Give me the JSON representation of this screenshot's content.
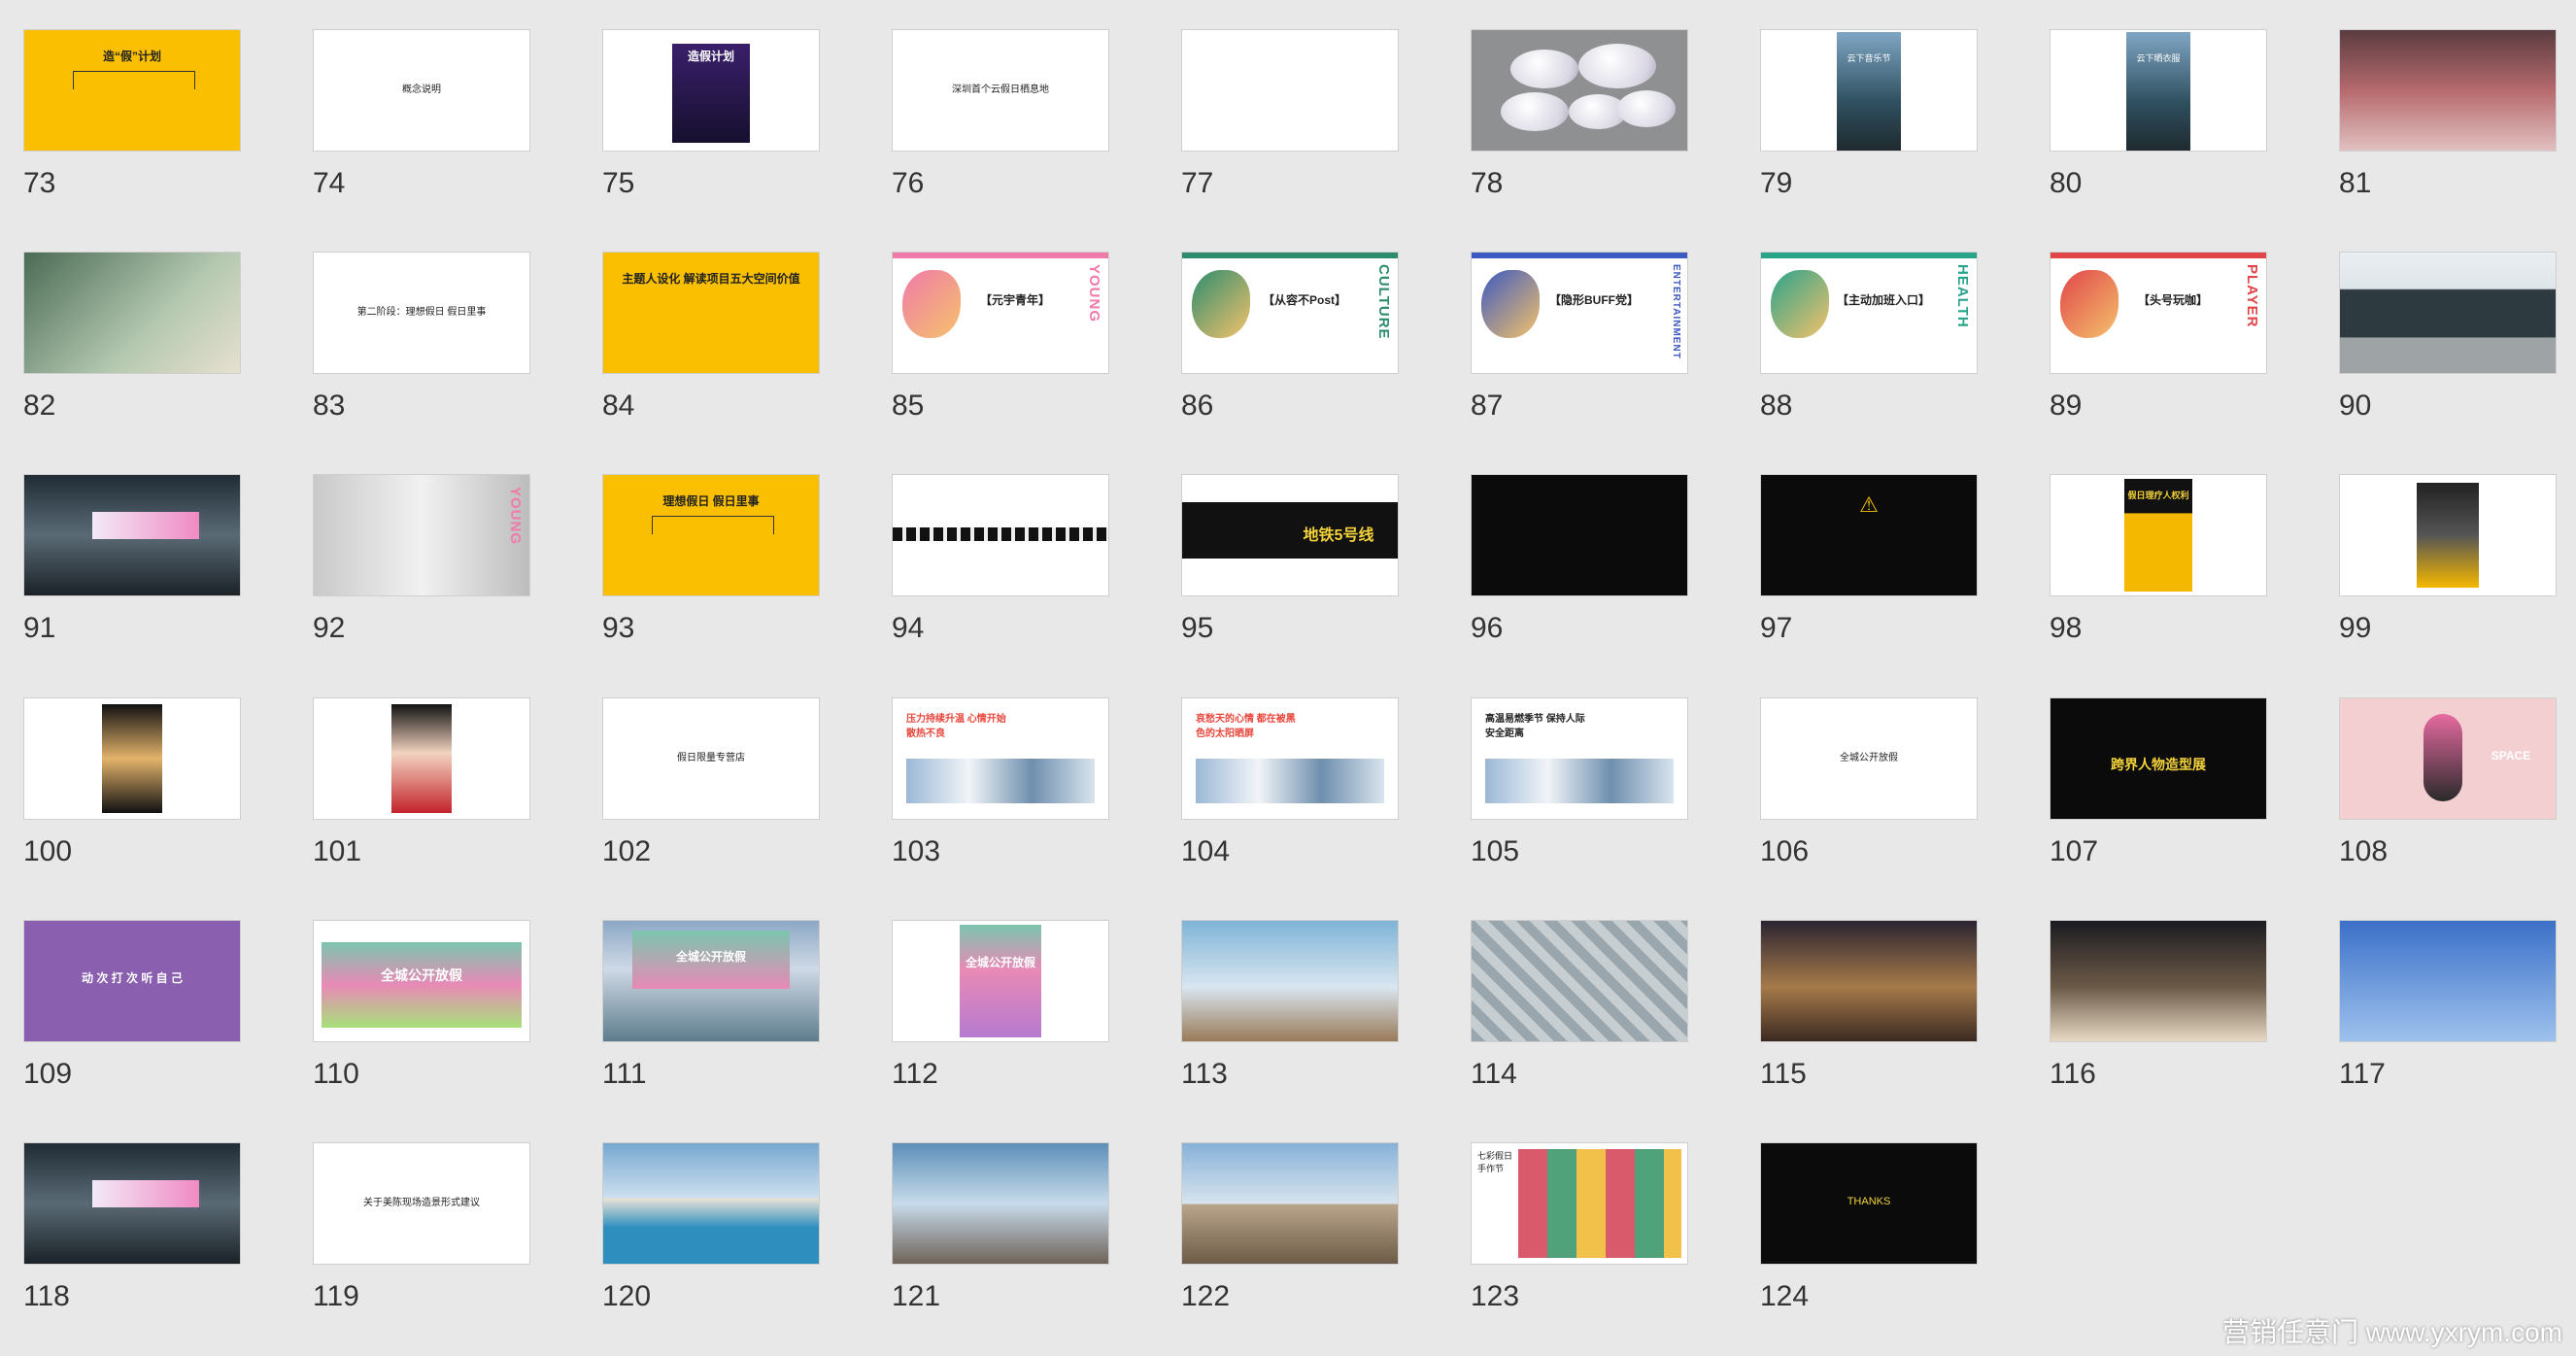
{
  "slides": [
    {
      "num": "73",
      "kind": "yellow",
      "title": "造“假”计划"
    },
    {
      "num": "74",
      "kind": "white",
      "title": "概念说明"
    },
    {
      "num": "75",
      "kind": "poster-dark",
      "title": "造假计划"
    },
    {
      "num": "76",
      "kind": "white",
      "title": "深圳首个云假日栖息地"
    },
    {
      "num": "77",
      "kind": "white",
      "title": ""
    },
    {
      "num": "78",
      "kind": "clouds",
      "title": ""
    },
    {
      "num": "79",
      "kind": "poster-photo",
      "title": "云下音乐节"
    },
    {
      "num": "80",
      "kind": "poster-photo",
      "title": "云下晒衣服"
    },
    {
      "num": "81",
      "kind": "photo",
      "title": ""
    },
    {
      "num": "82",
      "kind": "photo",
      "title": ""
    },
    {
      "num": "83",
      "kind": "white",
      "title": "第二阶段：理想假日 假日里事"
    },
    {
      "num": "84",
      "kind": "yellow",
      "title": "主题人设化 解读项目五大空间价值"
    },
    {
      "num": "85",
      "kind": "theme",
      "title": "【元宇青年】",
      "side": "YOUNG",
      "accent": "#f07aa9"
    },
    {
      "num": "86",
      "kind": "theme",
      "title": "【从容不Post】",
      "side": "CULTURE",
      "accent": "#2d8c6e"
    },
    {
      "num": "87",
      "kind": "theme",
      "title": "【隐形BUFF党】",
      "side": "ENTERTAINMENT",
      "accent": "#3c5ac0"
    },
    {
      "num": "88",
      "kind": "theme",
      "title": "【主动加班入口】",
      "side": "HEALTH",
      "accent": "#2aa38b"
    },
    {
      "num": "89",
      "kind": "theme",
      "title": "【头号玩咖】",
      "side": "PLAYER",
      "accent": "#e0454a"
    },
    {
      "num": "90",
      "kind": "street",
      "title": ""
    },
    {
      "num": "91",
      "kind": "tunnel",
      "title": ""
    },
    {
      "num": "92",
      "kind": "hall",
      "title": "",
      "side": "YOUNG"
    },
    {
      "num": "93",
      "kind": "yellow",
      "title": "理想假日 假日里事"
    },
    {
      "num": "94",
      "kind": "strip",
      "title": ""
    },
    {
      "num": "95",
      "kind": "metro",
      "title": "地铁5号线"
    },
    {
      "num": "96",
      "kind": "black",
      "title": ""
    },
    {
      "num": "97",
      "kind": "black-warn",
      "title": ""
    },
    {
      "num": "98",
      "kind": "poster-yellow",
      "title": "假日理疗人权利"
    },
    {
      "num": "99",
      "kind": "poster-white",
      "title": ""
    },
    {
      "num": "100",
      "kind": "poster-person",
      "title": ""
    },
    {
      "num": "101",
      "kind": "poster-person",
      "title": ""
    },
    {
      "num": "102",
      "kind": "white",
      "title": "假日限量专营店"
    },
    {
      "num": "103",
      "kind": "red-title",
      "title": "压力持续升温 心情开始散热不良"
    },
    {
      "num": "104",
      "kind": "red-title",
      "title": "哀愁天的心情 都在被黑色的太阳晒屏"
    },
    {
      "num": "105",
      "kind": "black-title",
      "title": "高温易燃季节 保持人际安全距离"
    },
    {
      "num": "106",
      "kind": "white",
      "title": "全城公开放假"
    },
    {
      "num": "107",
      "kind": "black-gold",
      "title": "跨界人物造型展"
    },
    {
      "num": "108",
      "kind": "pink",
      "title": "SPACE"
    },
    {
      "num": "109",
      "kind": "purple",
      "title": "动 次 打 次 听 自 己"
    },
    {
      "num": "110",
      "kind": "banner",
      "title": "全城公开放假"
    },
    {
      "num": "111",
      "kind": "billboard",
      "title": "全城公开放假"
    },
    {
      "num": "112",
      "kind": "poster-pink",
      "title": "全城公开放假"
    },
    {
      "num": "113",
      "kind": "building",
      "title": ""
    },
    {
      "num": "114",
      "kind": "facade",
      "title": ""
    },
    {
      "num": "115",
      "kind": "night",
      "title": ""
    },
    {
      "num": "116",
      "kind": "night2",
      "title": ""
    },
    {
      "num": "117",
      "kind": "sky",
      "title": ""
    },
    {
      "num": "118",
      "kind": "tunnel2",
      "title": ""
    },
    {
      "num": "119",
      "kind": "white",
      "title": "关于美陈现场造景形式建议"
    },
    {
      "num": "120",
      "kind": "pool",
      "title": ""
    },
    {
      "num": "121",
      "kind": "courtyard",
      "title": ""
    },
    {
      "num": "122",
      "kind": "car",
      "title": ""
    },
    {
      "num": "123",
      "kind": "collage",
      "title": "七彩假日手作节"
    },
    {
      "num": "124",
      "kind": "thanks",
      "title": "THANKS"
    }
  ],
  "watermark": "营销任意门 www.yxrym.com",
  "colors": {
    "yellow": "#f9bf00",
    "border": "#cfcfcf",
    "number": "#333333"
  }
}
